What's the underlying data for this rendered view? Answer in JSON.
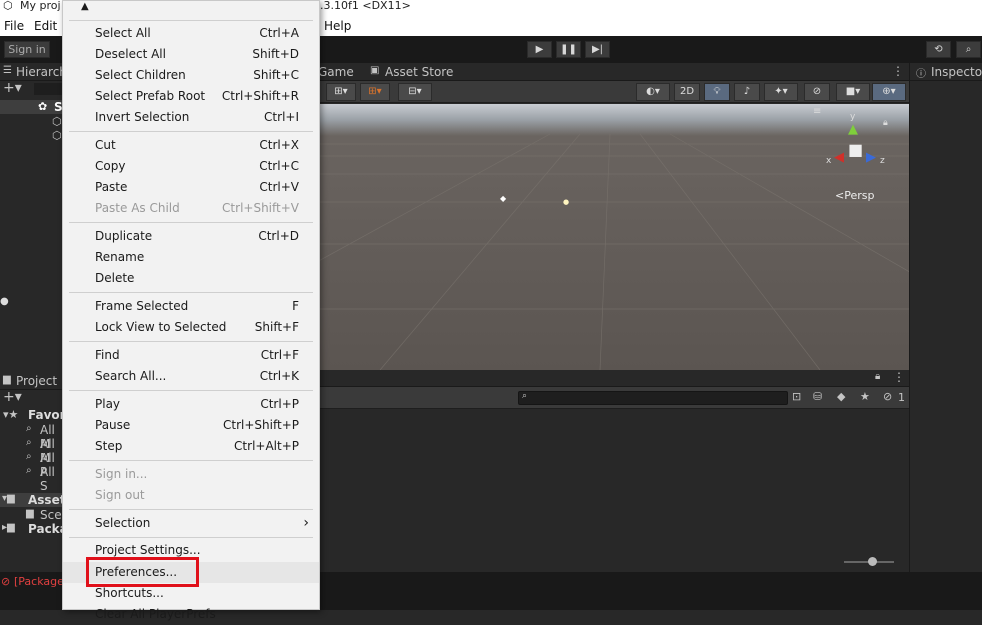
{
  "window": {
    "title_left": "My proj",
    "title_right": ".3.10f1 <DX11>"
  },
  "menubar": {
    "file": "File",
    "edit": "Edit",
    "help": "Help"
  },
  "toolbar": {
    "sign_in": "Sign in"
  },
  "panels": {
    "hierarchy": "Hierarch",
    "game_tab": "Game",
    "asset_store_tab": "Asset Store",
    "inspector": "Inspector",
    "project": "Project",
    "favorites": "Favori",
    "fav_items": [
      "All M",
      "All M",
      "All P",
      "All S"
    ],
    "assets": "Asset",
    "assets_child": "Scen",
    "packages": "Packa",
    "scene_root": "S"
  },
  "scene": {
    "view_2d": "2D",
    "persp": "<Persp",
    "axis_x": "x",
    "axis_y": "y",
    "axis_z": "z",
    "hidden_count": "1"
  },
  "status": {
    "error_text": "[Package"
  },
  "menu": {
    "items": [
      {
        "label": "Select All",
        "shortcut": "Ctrl+A"
      },
      {
        "label": "Deselect All",
        "shortcut": "Shift+D"
      },
      {
        "label": "Select Children",
        "shortcut": "Shift+C"
      },
      {
        "label": "Select Prefab Root",
        "shortcut": "Ctrl+Shift+R"
      },
      {
        "label": "Invert Selection",
        "shortcut": "Ctrl+I"
      },
      {
        "label": "Cut",
        "shortcut": "Ctrl+X"
      },
      {
        "label": "Copy",
        "shortcut": "Ctrl+C"
      },
      {
        "label": "Paste",
        "shortcut": "Ctrl+V"
      },
      {
        "label": "Paste As Child",
        "shortcut": "Ctrl+Shift+V"
      },
      {
        "label": "Duplicate",
        "shortcut": "Ctrl+D"
      },
      {
        "label": "Rename",
        "shortcut": ""
      },
      {
        "label": "Delete",
        "shortcut": ""
      },
      {
        "label": "Frame Selected",
        "shortcut": "F"
      },
      {
        "label": "Lock View to Selected",
        "shortcut": "Shift+F"
      },
      {
        "label": "Find",
        "shortcut": "Ctrl+F"
      },
      {
        "label": "Search All...",
        "shortcut": "Ctrl+K"
      },
      {
        "label": "Play",
        "shortcut": "Ctrl+P"
      },
      {
        "label": "Pause",
        "shortcut": "Ctrl+Shift+P"
      },
      {
        "label": "Step",
        "shortcut": "Ctrl+Alt+P"
      },
      {
        "label": "Sign in...",
        "shortcut": ""
      },
      {
        "label": "Sign out",
        "shortcut": ""
      },
      {
        "label": "Selection",
        "shortcut": "›"
      },
      {
        "label": "Project Settings...",
        "shortcut": ""
      },
      {
        "label": "Preferences...",
        "shortcut": ""
      },
      {
        "label": "Shortcuts...",
        "shortcut": ""
      },
      {
        "label": "Clear All PlayerPrefs",
        "shortcut": ""
      }
    ]
  },
  "colors": {
    "highlight_box": "#e0101a",
    "menu_bg": "#f2f2f2",
    "editor_bg": "#282828"
  }
}
